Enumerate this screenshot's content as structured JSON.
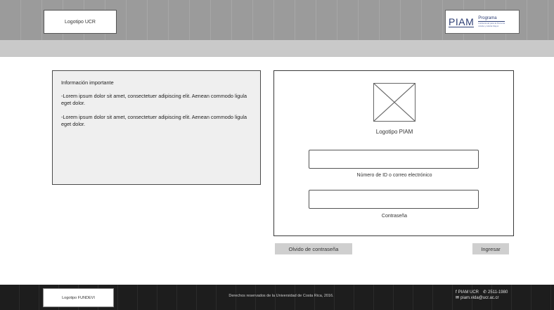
{
  "header": {
    "logo_ucr_label": "Logotipo UCR",
    "piam_logo": {
      "word": "PIAM",
      "program_label": "Programa",
      "program_sub_1": "Institucional para la Persona",
      "program_sub_2": "Adulta y Adulta Mayor"
    }
  },
  "info": {
    "title": "Información importante",
    "paragraphs": [
      "-Lorem ipsum dolor sit amet, consectetuer adipiscing elit. Aenean commodo ligula eget dolor.",
      "-Lorem ipsum dolor sit amet, consectetuer adipiscing elit. Aenean commodo ligula eget dolor."
    ]
  },
  "login": {
    "logo_label": "Logotipo PIAM",
    "id_field": {
      "value": "",
      "placeholder": "",
      "label": "Número de ID o correo electrónico"
    },
    "password_field": {
      "value": "",
      "placeholder": "",
      "label": "Contraseña"
    }
  },
  "buttons": {
    "forgot_label": "Olvido de contraseña",
    "login_label": "Ingresar"
  },
  "footer": {
    "logo_fundevi_label": "Logotipo FUNDEVI",
    "copyright": "Derechos reservados de la Universidad de Costa Rica, 2016.",
    "facebook": "PIAM UCR",
    "phone": "2511-1980",
    "email": "piam.vida@ucr.ac.cr"
  },
  "colors": {
    "header_bg": "#9b9b9b",
    "subheader_bg": "#c9c9c9",
    "footer_bg": "#1d1d1d",
    "button_bg": "#cfcfcf",
    "piam_blue": "#2d3e74"
  },
  "icons": {
    "logo_placeholder": "image-placeholder-icon",
    "facebook": "facebook-icon",
    "phone": "phone-icon",
    "email": "email-icon"
  }
}
